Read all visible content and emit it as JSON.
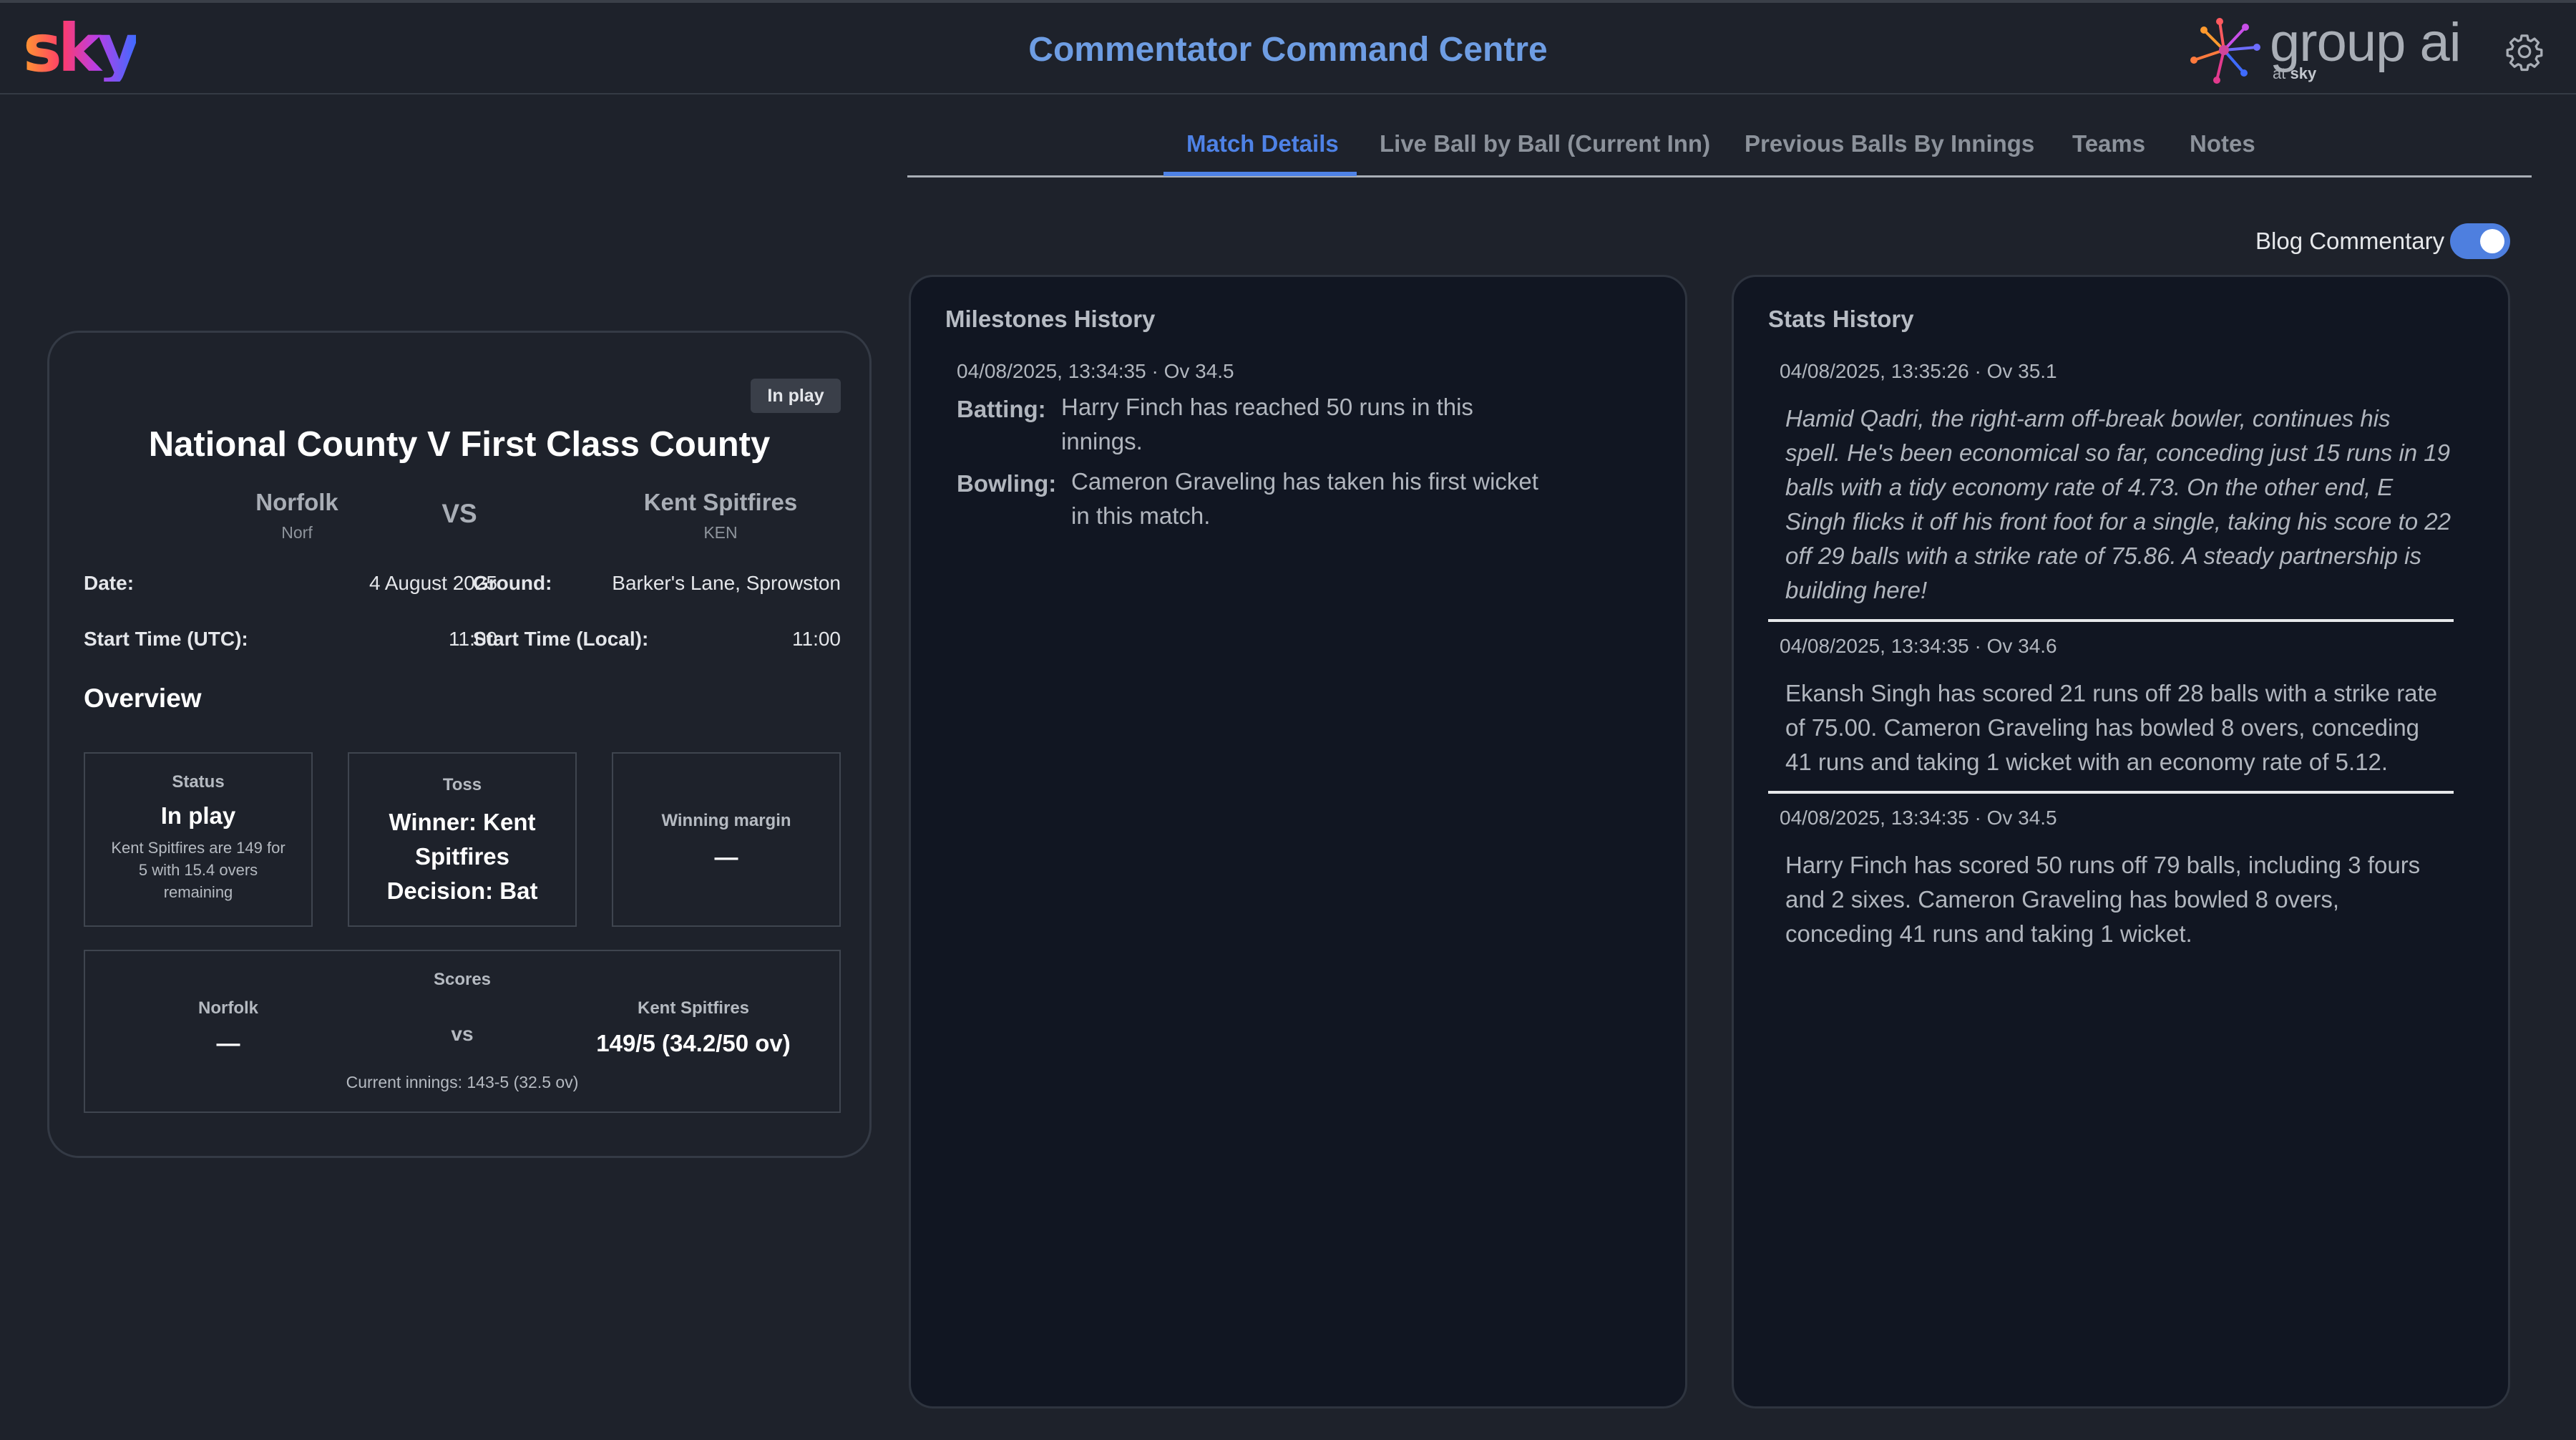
{
  "header": {
    "sky_logo": "sky",
    "title": "Commentator Command Centre",
    "group_ai_text": "group ai",
    "group_ai_sub_prefix": "at",
    "group_ai_sub_brand": "sky",
    "settings_icon": "gear-icon"
  },
  "tabs": [
    {
      "label": "Match Details",
      "active": true
    },
    {
      "label": "Live Ball by Ball (Current Inn)",
      "active": false
    },
    {
      "label": "Previous Balls By Innings",
      "active": false
    },
    {
      "label": "Teams",
      "active": false
    },
    {
      "label": "Notes",
      "active": false
    }
  ],
  "blog_toggle": {
    "label": "Blog Commentary",
    "on": true,
    "accent": "#4e7fdf"
  },
  "match": {
    "status_badge": "In play",
    "title": "National County V First Class County",
    "home": {
      "name": "Norfolk",
      "abbr": "Norf"
    },
    "vs": "VS",
    "away": {
      "name": "Kent Spitfires",
      "abbr": "KEN"
    },
    "details": {
      "date_label": "Date:",
      "date_value": "4 August 2025",
      "ground_label": "Ground:",
      "ground_value": "Barker's Lane, Sprowston",
      "start_utc_label": "Start Time (UTC):",
      "start_utc_value": "11:00",
      "start_local_label": "Start Time (Local):",
      "start_local_value": "11:00"
    },
    "overview_label": "Overview",
    "overview": {
      "status": {
        "label": "Status",
        "value": "In play",
        "note_1": "Kent Spitfires are 149 for",
        "note_2": "5 with 15.4 overs",
        "note_3": "remaining"
      },
      "toss": {
        "label": "Toss",
        "line_1": "Winner: Kent",
        "line_2": "Spitfires",
        "line_3": "Decision: Bat"
      },
      "margin": {
        "label": "Winning margin",
        "value": "—"
      }
    },
    "scores": {
      "label": "Scores",
      "home_name": "Norfolk",
      "home_score": "—",
      "vs": "vs",
      "away_name": "Kent Spitfires",
      "away_score": "149/5 (34.2/50 ov)",
      "current_innings": "Current innings: 143-5 (32.5 ov)"
    }
  },
  "milestones": {
    "title": "Milestones History",
    "entries": [
      {
        "timestamp": "04/08/2025, 13:34:35 · Ov 34.5",
        "items": [
          {
            "label": "Batting:",
            "line_1": "Harry Finch has reached 50 runs in this",
            "line_2": "innings."
          },
          {
            "label": "Bowling:",
            "line_1": "Cameron Graveling has taken his first wicket",
            "line_2": "in this match."
          }
        ]
      }
    ]
  },
  "stats": {
    "title": "Stats History",
    "entries": [
      {
        "timestamp": "04/08/2025, 13:35:26 · Ov 35.1",
        "italic": true,
        "text": "Hamid Qadri, the right-arm off-break bowler, continues his spell. He's been economical so far, conceding just 15 runs in 19 balls with a tidy economy rate of 4.73. On the other end, E Singh flicks it off his front foot for a single, taking his score to 22 off 29 balls with a strike rate of 75.86. A steady partnership is building here!"
      },
      {
        "timestamp": "04/08/2025, 13:34:35 · Ov 34.6",
        "italic": false,
        "text": "Ekansh Singh has scored 21 runs off 28 balls with a strike rate of 75.00. Cameron Graveling has bowled 8 overs, conceding 41 runs and taking 1 wicket with an economy rate of 5.12."
      },
      {
        "timestamp": "04/08/2025, 13:34:35 · Ov 34.5",
        "italic": false,
        "text": "Harry Finch has scored 50 runs off 79 balls, including 3 fours and 2 sixes. Cameron Graveling has bowled 8 overs, conceding 41 runs and taking 1 wicket."
      }
    ]
  }
}
